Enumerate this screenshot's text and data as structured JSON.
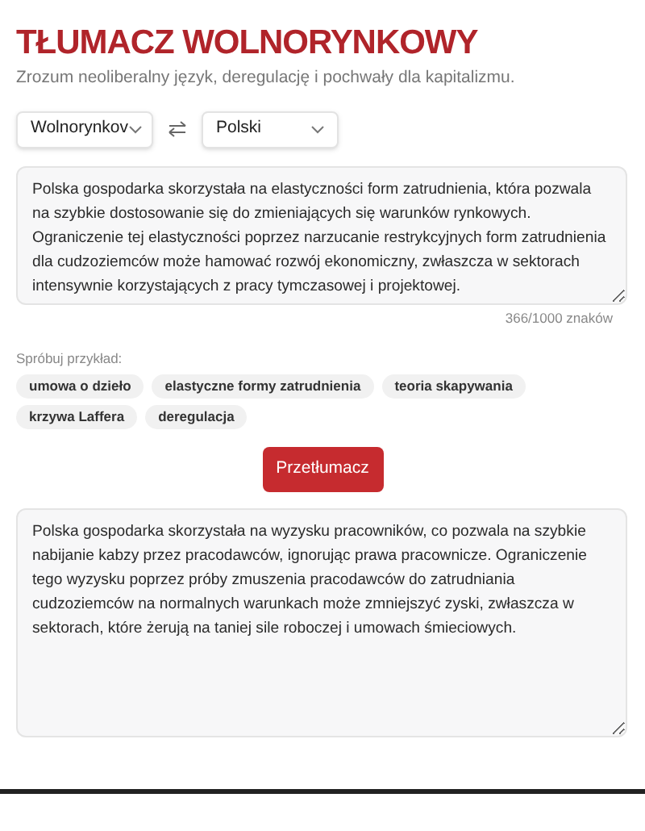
{
  "header": {
    "title": "TŁUMACZ WOLNORYNKOWY",
    "subtitle": "Zrozum neoliberalny język, deregulację i pochwały dla kapitalizmu."
  },
  "languages": {
    "source": "Wolnorynkov",
    "target": "Polski"
  },
  "input": {
    "value": "Polska gospodarka skorzystała na elastyczności form zatrudnienia, która pozwala na szybkie dostosowanie się do zmieniających się warunków rynkowych. Ograniczenie tej elastyczności poprzez narzucanie restrykcyjnych form zatrudnienia dla cudzoziemców może hamować rozwój ekonomiczny, zwłaszcza w sektorach intensywnie korzystających z pracy tymczasowej i projektowej.",
    "counter": "366/1000 znaków"
  },
  "examples": {
    "label": "Spróbuj przykład:",
    "chips": [
      "umowa o dzieło",
      "elastyczne formy zatrudnienia",
      "teoria skapywania",
      "krzywa Laffera",
      "deregulacja"
    ]
  },
  "translate_button": "Przetłumacz",
  "output": {
    "value": "Polska gospodarka skorzystała na wyzysku pracowników, co pozwala na szybkie nabijanie kabzy przez pracodawców, ignorując prawa pracownicze. Ograniczenie tego wyzysku poprzez próby zmuszenia pracodawców do zatrudniania cudzoziemców na normalnych warunkach może zmniejszyć zyski, zwłaszcza w sektorach, które żerują na taniej sile roboczej i umowach śmieciowych."
  }
}
